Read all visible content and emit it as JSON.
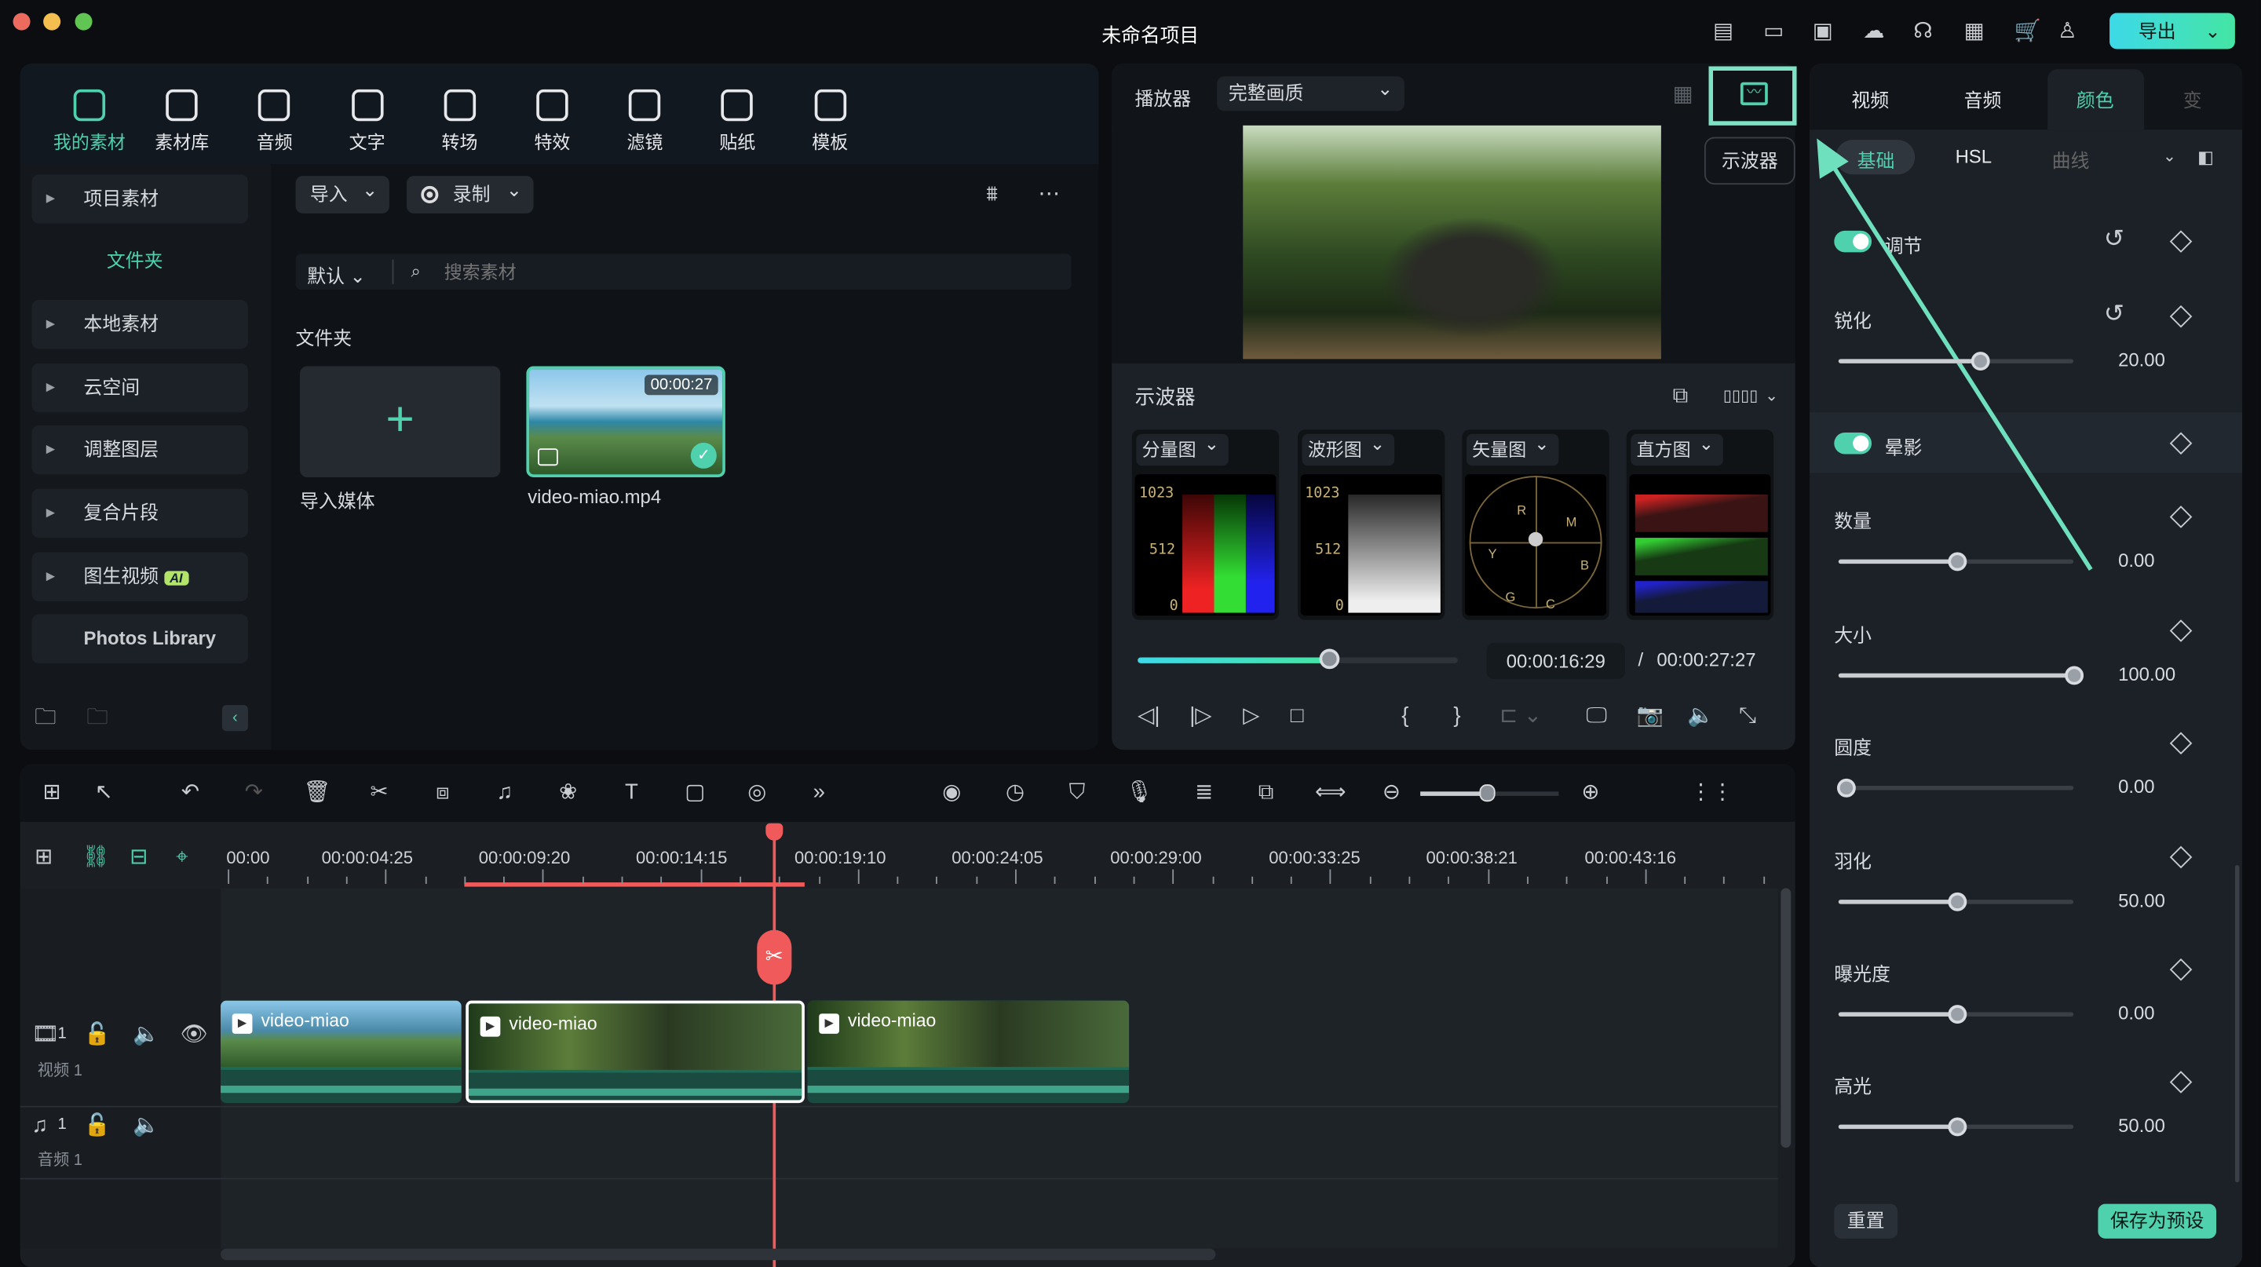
{
  "window": {
    "title": "未命名项目",
    "export_label": "导出"
  },
  "titlebar_icons": [
    "task-icon",
    "layout-icon",
    "save-icon",
    "cloud-upload-icon",
    "headset-icon",
    "apps-grid-icon",
    "cart-icon",
    "user-icon"
  ],
  "media": {
    "tabs": [
      {
        "label": "我的素材",
        "active": true
      },
      {
        "label": "素材库"
      },
      {
        "label": "音频"
      },
      {
        "label": "文字"
      },
      {
        "label": "转场"
      },
      {
        "label": "特效"
      },
      {
        "label": "滤镜"
      },
      {
        "label": "贴纸"
      },
      {
        "label": "模板"
      }
    ],
    "sidebar": {
      "items": [
        {
          "label": "项目素材"
        },
        {
          "label": "文件夹",
          "active": true
        },
        {
          "label": "本地素材"
        },
        {
          "label": "云空间"
        },
        {
          "label": "调整图层"
        },
        {
          "label": "复合片段"
        },
        {
          "label": "图生视频",
          "badge": "AI"
        },
        {
          "label": "Photos Library"
        }
      ]
    },
    "import_label": "导入",
    "record_label": "录制",
    "sort_label": "默认",
    "search_placeholder": "搜索素材",
    "folder_heading": "文件夹",
    "items": [
      {
        "label": "导入媒体"
      },
      {
        "label": "video-miao.mp4",
        "duration": "00:00:27"
      }
    ]
  },
  "player": {
    "label": "播放器",
    "quality": "完整画质",
    "tooltip": "示波器",
    "scopes_title": "示波器",
    "scopes": [
      {
        "label": "分量图",
        "ticks": [
          "1023",
          "512",
          "0"
        ]
      },
      {
        "label": "波形图",
        "ticks": [
          "1023",
          "512",
          "0"
        ]
      },
      {
        "label": "矢量图",
        "marks": [
          "R",
          "M",
          "Y",
          "B",
          "G",
          "C"
        ]
      },
      {
        "label": "直方图"
      }
    ],
    "current_time": "00:00:16:29",
    "separator": "/",
    "total_time": "00:00:27:27",
    "progress": 0.6
  },
  "inspector": {
    "tabs": [
      {
        "label": "视频"
      },
      {
        "label": "音频"
      },
      {
        "label": "颜色",
        "active": true
      },
      {
        "label": "变"
      }
    ],
    "subtabs": [
      {
        "label": "基础",
        "active": true
      },
      {
        "label": "HSL"
      },
      {
        "label": "曲线"
      }
    ],
    "sections": {
      "adjust": "调节",
      "vignette": "晕影"
    },
    "sliders": [
      {
        "label": "锐化",
        "value": "20.00",
        "fraction": 0.6
      },
      {
        "label": "数量",
        "value": "0.00",
        "fraction": 0.5
      },
      {
        "label": "大小",
        "value": "100.00",
        "fraction": 1.0
      },
      {
        "label": "圆度",
        "value": "0.00",
        "fraction": 0.03
      },
      {
        "label": "羽化",
        "value": "50.00",
        "fraction": 0.5
      },
      {
        "label": "曝光度",
        "value": "0.00",
        "fraction": 0.5
      },
      {
        "label": "高光",
        "value": "50.00",
        "fraction": 0.5
      }
    ],
    "reset_label": "重置",
    "save_preset_label": "保存为预设"
  },
  "timeline": {
    "ruler": [
      "00:00",
      "00:00:04:25",
      "00:00:09:20",
      "00:00:14:15",
      "00:00:19:10",
      "00:00:24:05",
      "00:00:29:00",
      "00:00:33:25",
      "00:00:38:21",
      "00:00:43:16"
    ],
    "tracks": [
      {
        "num": "1",
        "name": "视频 1"
      },
      {
        "num": "1",
        "name": "音频 1"
      }
    ],
    "clips": [
      {
        "label": "video-miao"
      },
      {
        "label": "video-miao",
        "selected": true
      },
      {
        "label": "video-miao"
      }
    ]
  },
  "colors": {
    "accent": "#4fd1ae",
    "playhead": "#f05a5a",
    "panel": "#14181d"
  }
}
